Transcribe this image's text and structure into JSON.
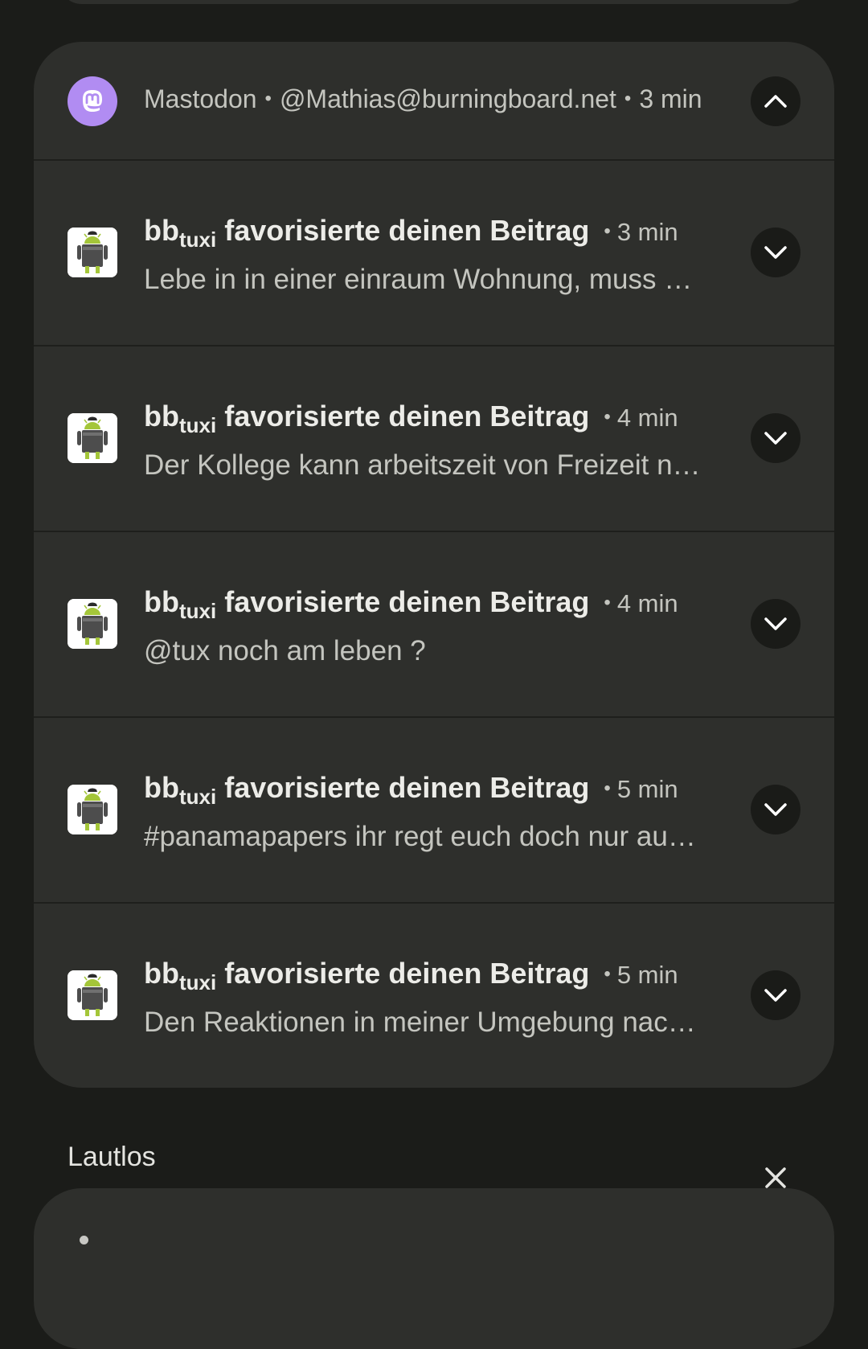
{
  "group": {
    "app_name": "Mastodon",
    "account": "@Mathias@burningboard.net",
    "time": "3 min",
    "separator": "•"
  },
  "notifications": [
    {
      "name_main": "bb",
      "name_sub": "tuxi",
      "action": "favorisierte deinen Beitrag",
      "time": "3 min",
      "text": "Lebe in in einer einraum Wohnung, muss …"
    },
    {
      "name_main": "bb",
      "name_sub": "tuxi",
      "action": "favorisierte deinen Beitrag",
      "time": "4 min",
      "text": "Der Kollege kann arbeitszeit von Freizeit n…"
    },
    {
      "name_main": "bb",
      "name_sub": "tuxi",
      "action": "favorisierte deinen Beitrag",
      "time": "4 min",
      "text": "@tux noch am leben ?"
    },
    {
      "name_main": "bb",
      "name_sub": "tuxi",
      "action": "favorisierte deinen Beitrag",
      "time": "5 min",
      "text": "#panamapapers ihr regt euch doch nur au…"
    },
    {
      "name_main": "bb",
      "name_sub": "tuxi",
      "action": "favorisierte deinen Beitrag",
      "time": "5 min",
      "text": "Den Reaktionen in meiner Umgebung nac…"
    }
  ],
  "silent_section": {
    "label": "Lautlos"
  },
  "icons": {
    "app": "mastodon-icon",
    "collapse": "chevron-up-icon",
    "expand": "chevron-down-icon",
    "avatar": "android-avatar-icon",
    "clear": "close-icon"
  },
  "colors": {
    "background": "#1b1c19",
    "card": "#2e2f2c",
    "mastodon_accent": "#b18cf2",
    "android_green": "#a4c639"
  }
}
